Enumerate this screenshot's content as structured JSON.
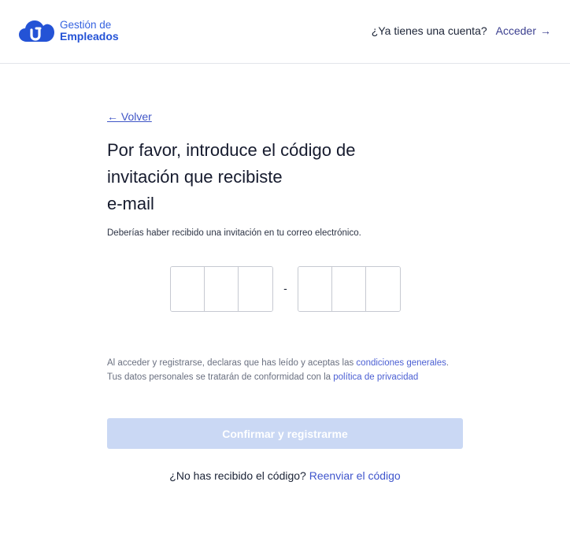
{
  "header": {
    "logo_line1": "Gestión de",
    "logo_line2": "Empleados",
    "logo_icon": "cloud-logo-icon",
    "question": "¿Ya tienes una cuenta?",
    "login_label": "Acceder",
    "login_icon": "arrow-right-icon"
  },
  "main": {
    "back_label": "← Volver",
    "title_line1": "Por favor, introduce el código de",
    "title_line2": "invitación que recibiste",
    "title_line3": "e-mail",
    "subtitle": "Deberías haber recibido una invitación en tu correo electrónico.",
    "code_separator": "-",
    "code_values": [
      "",
      "",
      "",
      "",
      "",
      ""
    ],
    "legal": {
      "text1": "Al acceder y registrarse, declaras que has leído y aceptas las ",
      "link1": "condiciones generales",
      "text2": ". Tus datos personales se tratarán de conformidad con la ",
      "link2": "política de privacidad"
    },
    "confirm_label": "Confirmar y registrarme",
    "resend_question": "¿No has recibido el código?",
    "resend_label": "Reenviar el código"
  },
  "colors": {
    "brand": "#2453d6",
    "link": "#4056c7",
    "button_disabled": "#cad8f4",
    "text": "#1b2336"
  }
}
